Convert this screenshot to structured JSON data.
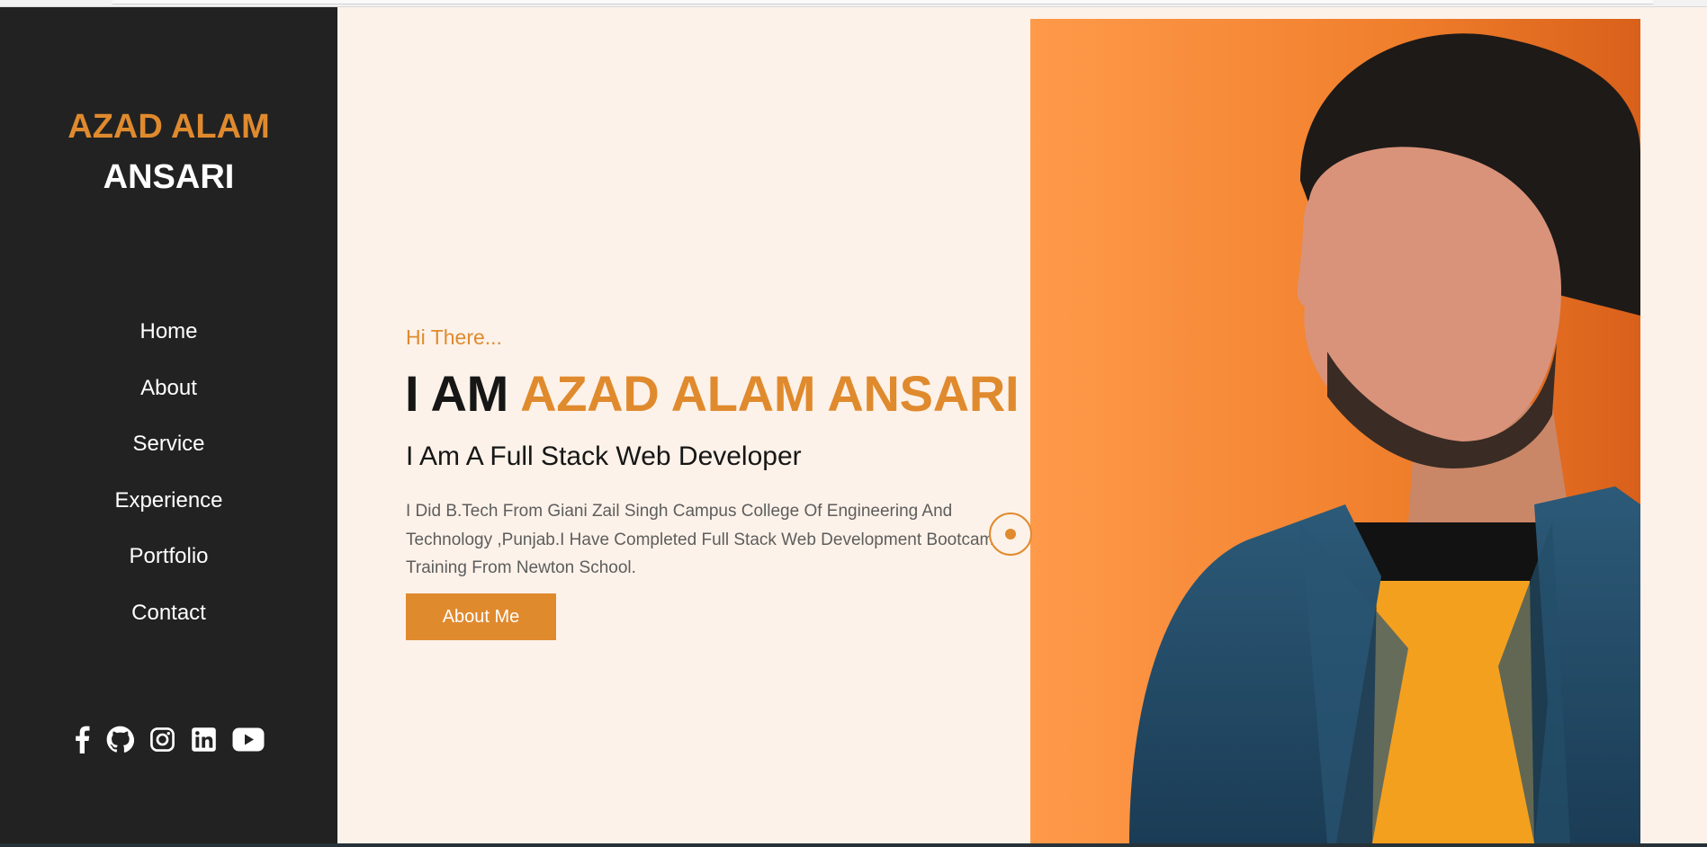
{
  "brand": {
    "line1": "AZAD ALAM",
    "line2": "ANSARI"
  },
  "nav": {
    "items": [
      {
        "label": "Home"
      },
      {
        "label": "About"
      },
      {
        "label": "Service"
      },
      {
        "label": "Experience"
      },
      {
        "label": "Portfolio"
      },
      {
        "label": "Contact"
      }
    ]
  },
  "social": [
    "facebook-icon",
    "github-icon",
    "instagram-icon",
    "linkedin-icon",
    "youtube-icon"
  ],
  "hero": {
    "greeting": "Hi There...",
    "headline_prefix": "I AM ",
    "headline_name": "AZAD ALAM ANSARI",
    "subtitle": "I Am A Full Stack Web Developer",
    "description": "I Did B.Tech From Giani Zail Singh Campus College Of Engineering And Technology ,Punjab.I Have Completed Full Stack Web Development Bootcamp Training From Newton School.",
    "button_label": "About Me"
  },
  "colors": {
    "accent": "#e08a2e",
    "sidebar": "#222222",
    "background": "#fdf2e9",
    "text": "#161616"
  }
}
